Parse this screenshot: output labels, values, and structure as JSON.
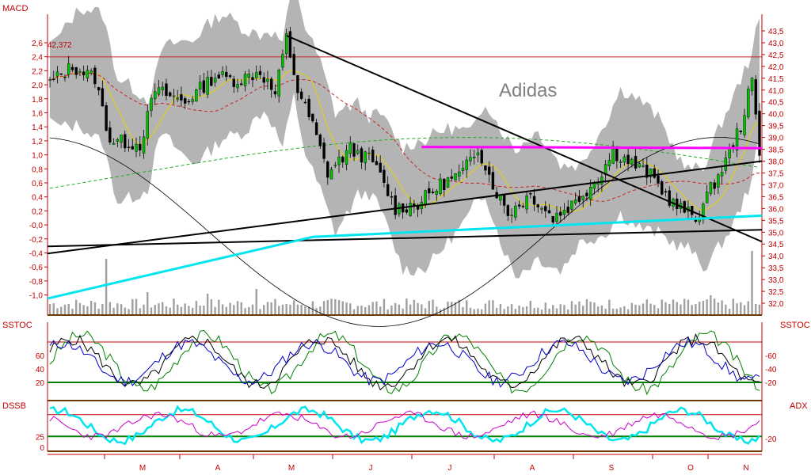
{
  "chart_data": [
    {
      "type": "candlestick",
      "panel": "price",
      "title": "Adidas",
      "left_axis_label": "MACD",
      "left_ticks": [
        "2,6",
        "2,4",
        "2,2",
        "2,0",
        "1,8",
        "1,6",
        "1,4",
        "1,2",
        "1,0",
        "0,8",
        "0,6",
        "0,4",
        "0,2",
        "-0,0",
        "-0,2",
        "-0,4",
        "-0,6",
        "-0,8",
        "-1,0"
      ],
      "right_ticks": [
        "43,5",
        "43,0",
        "42,5",
        "42,0",
        "41,5",
        "41,0",
        "40,5",
        "40,0",
        "39,5",
        "39,0",
        "38,5",
        "38,0",
        "37,5",
        "37,0",
        "36,5",
        "36,0",
        "35,5",
        "35,0",
        "34,5",
        "34,0",
        "33,5",
        "33,0",
        "32,5",
        "32,0"
      ],
      "annotation": "42,372",
      "resistance_level": 42.4,
      "last_close": 38.4,
      "price_range": [
        31.7,
        43.8
      ],
      "time_labels": [
        "M",
        "A",
        "M",
        "J",
        "J",
        "A",
        "S",
        "O",
        "N"
      ],
      "overlays": [
        "Bollinger band (grey)",
        "moving average (yellow)",
        "moving average (red, dashed)",
        "moving average (green, dashed)",
        "trend lines (black)",
        "channel line (magenta)",
        "support line (cyan)",
        "MACD line (black)",
        "volume bars"
      ],
      "colors": {
        "bands": "#b4b4b4",
        "ma_yellow": "#e6d200",
        "ma_red": "#cc2222",
        "ma_green": "#22aa22",
        "trend": "#000000",
        "magenta": "#ff00ff",
        "cyan": "#00e5ee",
        "axis": "#c00000"
      }
    },
    {
      "type": "line",
      "panel": "oscillator",
      "label_left": "SSTOC",
      "label_right": "SSTOC",
      "left_ticks": [
        "60",
        "40",
        "20"
      ],
      "right_ticks": [
        "-60",
        "-40",
        "-20"
      ],
      "ylim": [
        0,
        100
      ],
      "levels": [
        80,
        20
      ],
      "colors": {
        "fast": "#008000",
        "slow": "#000000",
        "signal": "#0000cc",
        "level_high": "#c00000",
        "level_low": "#008000"
      }
    },
    {
      "type": "line",
      "panel": "indicator",
      "label_left": "DSSB",
      "label_right": "ADX",
      "left_ticks": [
        "25",
        "0"
      ],
      "right_ticks": [
        "-20"
      ],
      "ylim": [
        0,
        100
      ],
      "levels": [
        75,
        25
      ],
      "colors": {
        "dssb": "#00e5ee",
        "adx": "#cc00cc",
        "level_high": "#c00000",
        "level_low": "#008000"
      }
    }
  ]
}
